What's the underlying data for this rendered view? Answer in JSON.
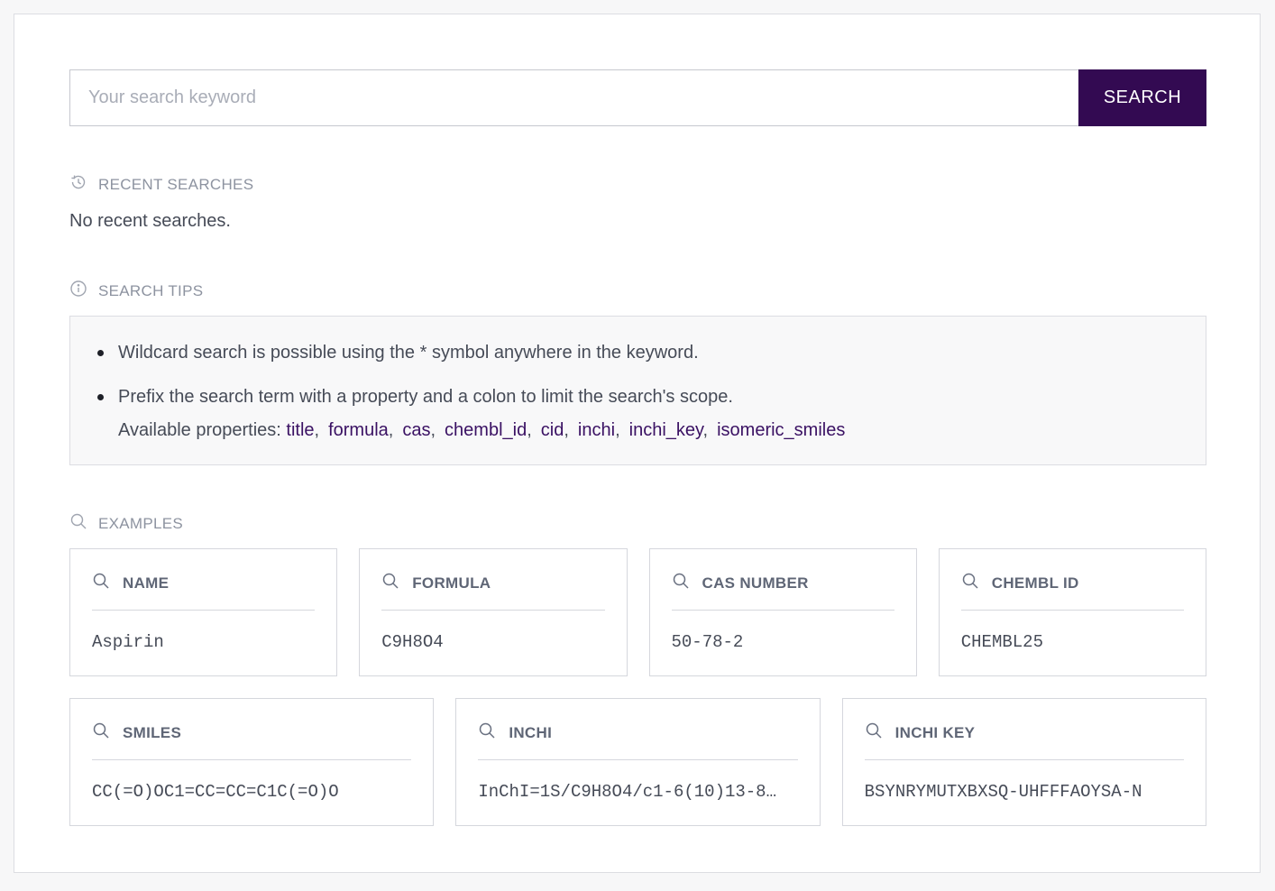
{
  "search": {
    "placeholder": "Your search keyword",
    "button_label": "SEARCH"
  },
  "recent": {
    "heading": "RECENT SEARCHES",
    "empty_text": "No recent searches."
  },
  "tips": {
    "heading": "SEARCH TIPS",
    "tip1": "Wildcard search is possible using the * symbol anywhere in the keyword.",
    "tip2": "Prefix the search term with a property and a colon to limit the search's scope.",
    "props_label": "Available properties: ",
    "properties": [
      "title",
      "formula",
      "cas",
      "chembl_id",
      "cid",
      "inchi",
      "inchi_key",
      "isomeric_smiles"
    ]
  },
  "examples": {
    "heading": "EXAMPLES",
    "cards": [
      {
        "label": "NAME",
        "value": "Aspirin"
      },
      {
        "label": "FORMULA",
        "value": "C9H8O4"
      },
      {
        "label": "CAS NUMBER",
        "value": "50-78-2"
      },
      {
        "label": "CHEMBL ID",
        "value": "CHEMBL25"
      },
      {
        "label": "SMILES",
        "value": "CC(=O)OC1=CC=CC=C1C(=O)O"
      },
      {
        "label": "INCHI",
        "value": "InChI=1S/C9H8O4/c1-6(10)13-8…"
      },
      {
        "label": "INCHI KEY",
        "value": "BSYNRYMUTXBXSQ-UHFFFAOYSA-N"
      }
    ]
  },
  "colors": {
    "accent": "#330a52",
    "link": "#3a1163",
    "muted": "#8d93a0"
  },
  "icons": {
    "recent": "history-icon",
    "tips": "info-icon",
    "examples": "search-icon"
  }
}
